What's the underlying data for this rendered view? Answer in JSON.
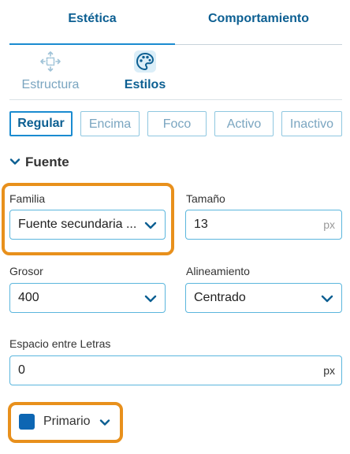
{
  "top_tabs": [
    {
      "label": "Estética",
      "active": true
    },
    {
      "label": "Comportamiento",
      "active": false
    }
  ],
  "sub_tabs": [
    {
      "label": "Estructura",
      "icon": "move-arrows-icon",
      "active": false
    },
    {
      "label": "Estilos",
      "icon": "palette-icon",
      "active": true
    }
  ],
  "states": [
    "Regular",
    "Encima",
    "Foco",
    "Activo",
    "Inactivo"
  ],
  "font_section": {
    "title": "Fuente",
    "family": {
      "label": "Familia",
      "value": "Fuente secundaria ..."
    },
    "size": {
      "label": "Tamaño",
      "value": "13",
      "unit": "px"
    },
    "weight": {
      "label": "Grosor",
      "value": "400"
    },
    "alignment": {
      "label": "Alineamiento",
      "value": "Centrado"
    },
    "letter_spacing": {
      "label": "Espacio entre Letras",
      "value": "0",
      "unit": "px"
    }
  },
  "color": {
    "label": "Primario",
    "swatch": "#0d66b3"
  },
  "colors": {
    "accent": "#1a8bd0",
    "heading": "#0c5f92",
    "highlight": "#e8901c"
  }
}
